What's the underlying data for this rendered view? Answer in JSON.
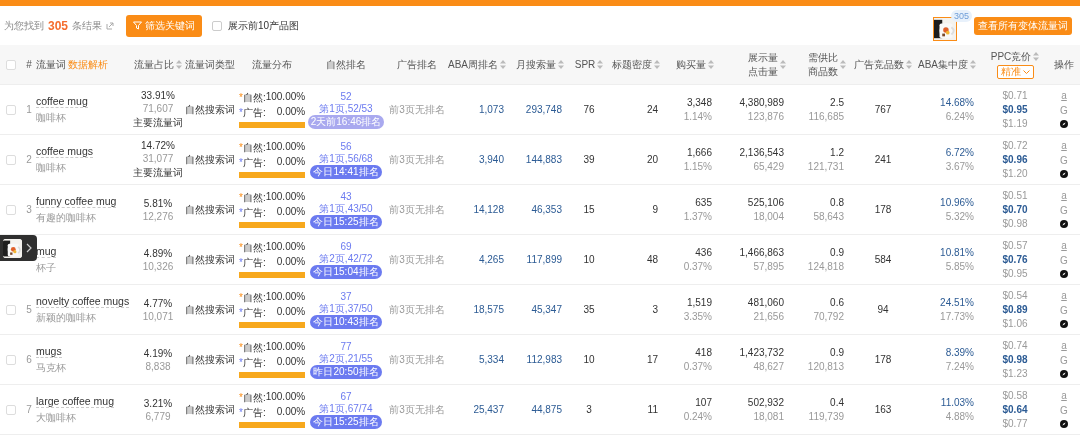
{
  "toolbar": {
    "result_prefix": "为您找到",
    "result_count": "305",
    "result_suffix": "条结果",
    "filter_button": "筛选关键词",
    "show_images": {
      "label": "展示前10产品图",
      "checked": false
    },
    "image_badge": "305",
    "variants_button": "查看所有变体流量词"
  },
  "table": {
    "columns": [
      {
        "kind": "checkbox",
        "checked": false
      },
      {
        "kind": "text",
        "label": "#",
        "sortable": false
      },
      {
        "kind": "text",
        "label": "流量词",
        "note": "数据解析",
        "sortable": false
      },
      {
        "kind": "text",
        "label": "流量占比",
        "sortable": true
      },
      {
        "kind": "text",
        "label": "流量词类型",
        "sortable": false
      },
      {
        "kind": "text",
        "label": "流量分布",
        "sortable": false
      },
      {
        "kind": "text",
        "label": "自然排名",
        "sortable": false
      },
      {
        "kind": "text",
        "label": "广告排名",
        "sortable": false
      },
      {
        "kind": "text",
        "label": "ABA周排名",
        "sortable": true
      },
      {
        "kind": "text",
        "label": "月搜索量",
        "sortable": true
      },
      {
        "kind": "text",
        "label": "SPR",
        "sortable": true
      },
      {
        "kind": "text",
        "label": "标题密度",
        "sortable": true
      },
      {
        "kind": "text",
        "label": "购买量",
        "sortable": true
      },
      {
        "kind": "text",
        "label": "展示量",
        "label2": "点击量",
        "sortable": true
      },
      {
        "kind": "text",
        "label": "需供比",
        "label2": "商品数",
        "sortable": true
      },
      {
        "kind": "text",
        "label": "广告竞品数",
        "sortable": true
      },
      {
        "kind": "text",
        "label": "ABA集中度",
        "sortable": true
      },
      {
        "kind": "ppc",
        "label": "PPC竞价",
        "match": "精准",
        "sortable": true
      },
      {
        "kind": "text",
        "label": "操作",
        "sortable": false
      }
    ],
    "rows": [
      {
        "checked": false,
        "index": "1",
        "keyword": "coffee mug",
        "translation": "咖啡杯",
        "share": "33.91%",
        "volume": "71,607",
        "tag": "主要流量词",
        "type": "自然搜索词",
        "dist": {
          "natural_mark": "*",
          "natural_label": "自然:",
          "natural": "100.00%",
          "ad_mark": "*",
          "ad_label": "广告:",
          "ad": "0.00%",
          "level": 1
        },
        "rank": {
          "value": "52",
          "page": "第1页,52/53",
          "badge": "2天前16:46排名",
          "color": "#a9a9ef"
        },
        "ad_rank": "前3页无排名",
        "aba_rank": "1,073",
        "monthly": "293,748",
        "spr": "76",
        "title_density": "24",
        "purchases": "3,348",
        "purchase_rate": "1.14%",
        "impressions": "4,380,989",
        "clicks": "123,876",
        "supply_ratio": "2.5",
        "products": "116,685",
        "ad_competitors": "767",
        "aba": "14.68%",
        "aba2": "6.24%",
        "ppc": [
          "$0.71",
          "$0.95",
          "$1.19"
        ],
        "actions": [
          "a",
          "G"
        ]
      },
      {
        "checked": false,
        "index": "2",
        "keyword": "coffee mugs",
        "translation": "咖啡杯",
        "share": "14.72%",
        "volume": "31,077",
        "tag": "主要流量词",
        "type": "自然搜索词",
        "dist": {
          "natural_mark": "*",
          "natural_label": "自然:",
          "natural": "100.00%",
          "ad_mark": "*",
          "ad_label": "广告:",
          "ad": "0.00%",
          "level": 1
        },
        "rank": {
          "value": "56",
          "page": "第1页,56/68",
          "badge": "今日14:41排名",
          "color": "#6b7af0"
        },
        "ad_rank": "前3页无排名",
        "aba_rank": "3,940",
        "monthly": "144,883",
        "spr": "39",
        "title_density": "20",
        "purchases": "1,666",
        "purchase_rate": "1.15%",
        "impressions": "2,136,543",
        "clicks": "65,429",
        "supply_ratio": "1.2",
        "products": "121,731",
        "ad_competitors": "241",
        "aba": "6.72%",
        "aba2": "3.67%",
        "ppc": [
          "$0.72",
          "$0.96",
          "$1.20"
        ],
        "actions": [
          "a",
          "G"
        ]
      },
      {
        "checked": false,
        "index": "3",
        "keyword": "funny coffee mug",
        "translation": "有趣的咖啡杯",
        "share": "5.81%",
        "volume": "12,276",
        "type": "自然搜索词",
        "dist": {
          "natural_mark": "*",
          "natural_label": "自然:",
          "natural": "100.00%",
          "ad_mark": "*",
          "ad_label": "广告:",
          "ad": "0.00%",
          "level": 1
        },
        "rank": {
          "value": "43",
          "page": "第1页,43/50",
          "badge": "今日15:25排名",
          "color": "#6b7af0"
        },
        "ad_rank": "前3页无排名",
        "aba_rank": "14,128",
        "monthly": "46,353",
        "spr": "15",
        "title_density": "9",
        "purchases": "635",
        "purchase_rate": "1.37%",
        "impressions": "525,106",
        "clicks": "18,004",
        "supply_ratio": "0.8",
        "products": "58,643",
        "ad_competitors": "178",
        "aba": "10.96%",
        "aba2": "5.32%",
        "ppc": [
          "$0.51",
          "$0.70",
          "$0.98"
        ],
        "actions": [
          "a",
          "G"
        ]
      },
      {
        "keyword": "mug",
        "translation": "杯子",
        "share": "4.89%",
        "volume": "10,326",
        "type": "自然搜索词",
        "dist": {
          "natural_mark": "*",
          "natural_label": "自然:",
          "natural": "100.00%",
          "ad_mark": "*",
          "ad_label": "广告:",
          "ad": "0.00%",
          "level": 1
        },
        "rank": {
          "value": "69",
          "page": "第2页,42/72",
          "badge": "今日15:04排名",
          "color": "#6b7af0"
        },
        "ad_rank": "前3页无排名",
        "aba_rank": "4,265",
        "monthly": "117,899",
        "spr": "10",
        "title_density": "48",
        "purchases": "436",
        "purchase_rate": "0.37%",
        "impressions": "1,466,863",
        "clicks": "57,895",
        "supply_ratio": "0.9",
        "products": "124,818",
        "ad_competitors": "584",
        "aba": "10.81%",
        "aba2": "5.85%",
        "ppc": [
          "$0.57",
          "$0.76",
          "$0.95"
        ],
        "actions": [
          "a",
          "G"
        ]
      },
      {
        "checked": false,
        "index": "5",
        "keyword": "novelty coffee mugs",
        "translation": "新颖的咖啡杯",
        "share": "4.77%",
        "volume": "10,071",
        "type": "自然搜索词",
        "dist": {
          "natural_mark": "*",
          "natural_label": "自然:",
          "natural": "100.00%",
          "ad_mark": "*",
          "ad_label": "广告:",
          "ad": "0.00%",
          "level": 1
        },
        "rank": {
          "value": "37",
          "page": "第1页,37/50",
          "badge": "今日10:43排名",
          "color": "#6b7af0"
        },
        "ad_rank": "前3页无排名",
        "aba_rank": "18,575",
        "monthly": "45,347",
        "spr": "35",
        "title_density": "3",
        "purchases": "1,519",
        "purchase_rate": "3.35%",
        "impressions": "481,060",
        "clicks": "21,656",
        "supply_ratio": "0.6",
        "products": "70,792",
        "ad_competitors": "94",
        "aba": "24.51%",
        "aba2": "17.73%",
        "ppc": [
          "$0.54",
          "$0.89",
          "$1.06"
        ],
        "actions": [
          "a",
          "G"
        ]
      },
      {
        "checked": false,
        "index": "6",
        "keyword": "mugs",
        "translation": "马克杯",
        "share": "4.19%",
        "volume": "8,838",
        "type": "自然搜索词",
        "dist": {
          "natural_mark": "*",
          "natural_label": "自然:",
          "natural": "100.00%",
          "ad_mark": "*",
          "ad_label": "广告:",
          "ad": "0.00%",
          "level": 1
        },
        "rank": {
          "value": "77",
          "page": "第2页,21/55",
          "badge": "昨日20:50排名",
          "color": "#6b7af0"
        },
        "ad_rank": "前3页无排名",
        "aba_rank": "5,334",
        "monthly": "112,983",
        "spr": "10",
        "title_density": "17",
        "purchases": "418",
        "purchase_rate": "0.37%",
        "impressions": "1,423,732",
        "clicks": "48,627",
        "supply_ratio": "0.9",
        "products": "120,813",
        "ad_competitors": "178",
        "aba": "8.39%",
        "aba2": "7.24%",
        "ppc": [
          "$0.74",
          "$0.98",
          "$1.23"
        ],
        "actions": [
          "a",
          "G"
        ]
      },
      {
        "checked": false,
        "index": "7",
        "keyword": "large coffee mug",
        "translation": "大咖啡杯",
        "share": "3.21%",
        "volume": "6,779",
        "type": "自然搜索词",
        "dist": {
          "natural_mark": "*",
          "natural_label": "自然:",
          "natural": "100.00%",
          "ad_mark": "*",
          "ad_label": "广告:",
          "ad": "0.00%",
          "level": 1
        },
        "rank": {
          "value": "67",
          "page": "第1页,67/74",
          "badge": "今日15:25排名",
          "color": "#6b7af0"
        },
        "ad_rank": "前3页无排名",
        "aba_rank": "25,437",
        "monthly": "44,875",
        "spr": "3",
        "title_density": "11",
        "purchases": "107",
        "purchase_rate": "0.24%",
        "impressions": "502,932",
        "clicks": "18,081",
        "supply_ratio": "0.4",
        "products": "119,739",
        "ad_competitors": "163",
        "aba": "11.03%",
        "aba2": "4.88%",
        "ppc": [
          "$0.58",
          "$0.64",
          "$0.77"
        ],
        "actions": [
          "a",
          "G"
        ]
      }
    ]
  }
}
